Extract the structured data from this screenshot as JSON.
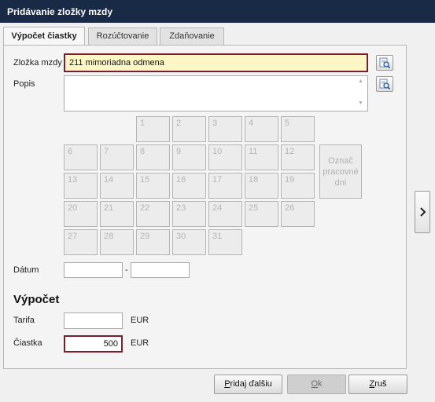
{
  "window": {
    "title": "Pridávanie zložky mzdy"
  },
  "tabs": [
    {
      "label": "Výpočet čiastky",
      "active": true
    },
    {
      "label": "Rozúčtovanie",
      "active": false
    },
    {
      "label": "Zdaňovanie",
      "active": false
    }
  ],
  "form": {
    "component_label": "Zložka mzdy",
    "component_value": "211  mimoriadna odmena",
    "description_label": "Popis",
    "description_value": "",
    "date_label": "Dátum",
    "date_from": "",
    "date_separator": "-",
    "date_to": ""
  },
  "calendar": {
    "days": [
      "1",
      "2",
      "3",
      "4",
      "5",
      "6",
      "7",
      "8",
      "9",
      "10",
      "11",
      "12",
      "13",
      "14",
      "15",
      "16",
      "17",
      "18",
      "19",
      "20",
      "21",
      "22",
      "23",
      "24",
      "25",
      "26",
      "27",
      "28",
      "29",
      "30",
      "31"
    ],
    "mark_workdays_label": "Označ pracovné dni"
  },
  "calculation": {
    "heading": "Výpočet",
    "rate_label": "Tarifa",
    "rate_value": "",
    "rate_currency": "EUR",
    "amount_label": "Čiastka",
    "amount_value": "500",
    "amount_currency": "EUR"
  },
  "buttons": {
    "add_next_mnemonic": "P",
    "add_next_rest": "ridaj ďalšiu",
    "ok_mnemonic": "O",
    "ok_rest": "k",
    "cancel_mnemonic": "Z",
    "cancel_rest": "ruš"
  },
  "colors": {
    "titlebar": "#182a46",
    "highlight_border": "#7c1d2e",
    "component_field_bg": "#fdf7c6"
  },
  "icons": {
    "lookup": "magnifier-list-icon",
    "side": "chevron-right-icon"
  }
}
